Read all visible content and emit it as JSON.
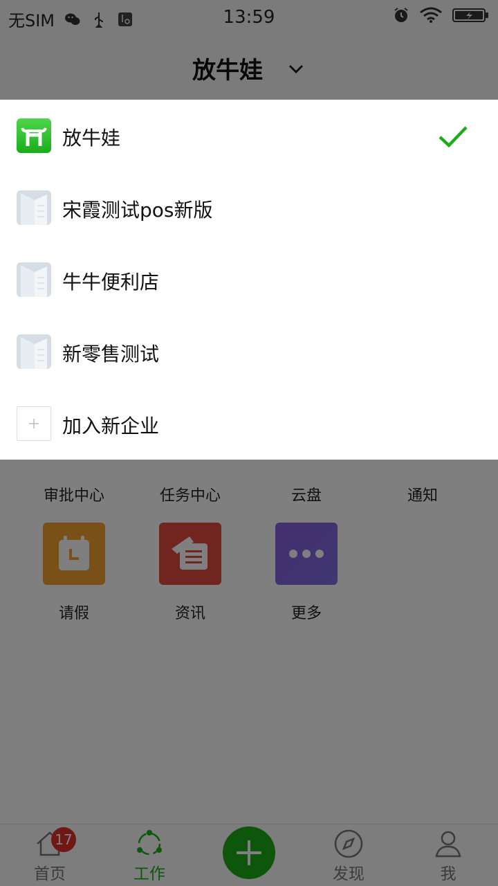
{
  "status_bar": {
    "carrier": "无SIM",
    "time": "13:59"
  },
  "header": {
    "title": "放牛娃"
  },
  "dropdown": {
    "items": [
      {
        "name": "放牛娃",
        "selected": true
      },
      {
        "name": "宋霞测试pos新版",
        "selected": false
      },
      {
        "name": "牛牛便利店",
        "selected": false
      },
      {
        "name": "新零售测试",
        "selected": false
      }
    ],
    "join_label": "加入新企业"
  },
  "apps": {
    "row1": [
      "审批中心",
      "任务中心",
      "云盘",
      "通知"
    ],
    "row2": [
      "请假",
      "资讯",
      "更多"
    ]
  },
  "tabs": {
    "home": "首页",
    "work": "工作",
    "discover": "发现",
    "me": "我",
    "home_badge": "17"
  },
  "colors": {
    "brand_green": "#1aad19",
    "badge_red": "#e0312b"
  }
}
